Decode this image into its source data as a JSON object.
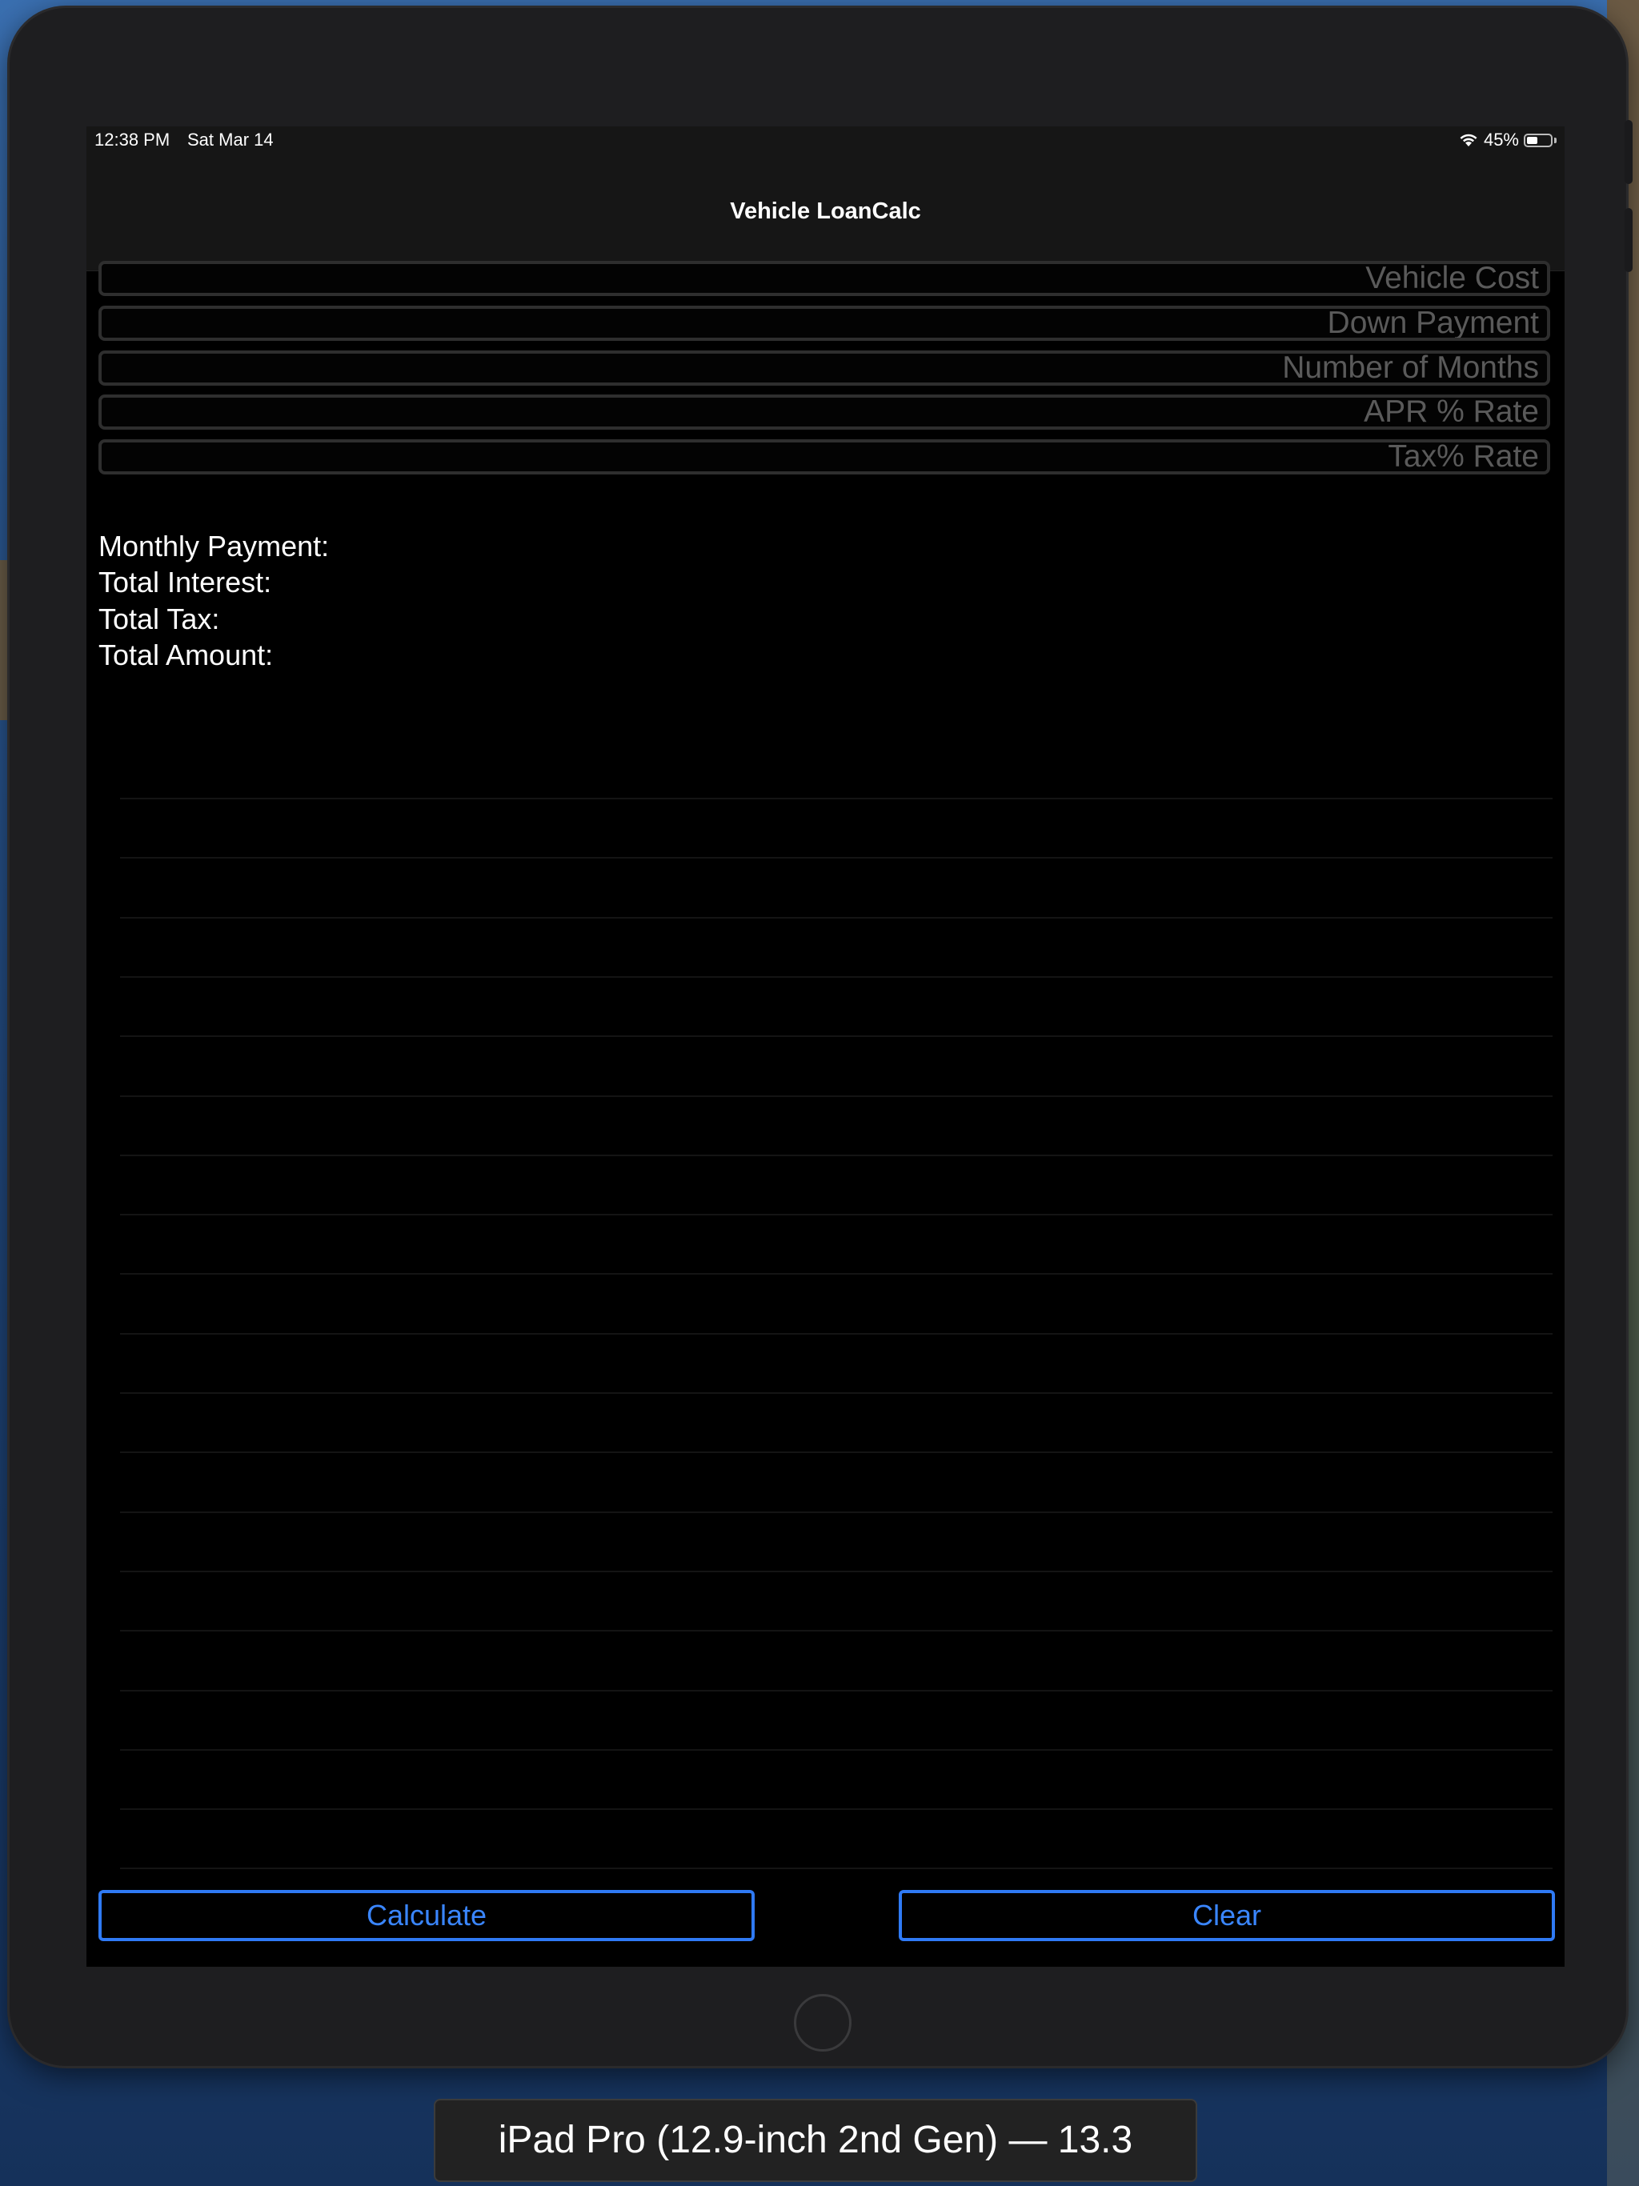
{
  "status_bar": {
    "time": "12:38 PM",
    "date": "Sat Mar 14",
    "battery_percent": "45%",
    "battery_level": 0.45,
    "wifi_icon": "wifi-icon"
  },
  "nav": {
    "title": "Vehicle LoanCalc"
  },
  "inputs": {
    "vehicle_cost": {
      "placeholder": "Vehicle Cost",
      "value": ""
    },
    "down_payment": {
      "placeholder": "Down Payment",
      "value": ""
    },
    "months": {
      "placeholder": "Number of Months",
      "value": ""
    },
    "apr": {
      "placeholder": "APR % Rate",
      "value": ""
    },
    "tax": {
      "placeholder": "Tax% Rate",
      "value": ""
    }
  },
  "results": {
    "monthly_payment": "Monthly Payment:",
    "total_interest": "Total Interest:",
    "total_tax": "Total Tax:",
    "total_amount": "Total Amount:"
  },
  "buttons": {
    "calculate": "Calculate",
    "clear": "Clear"
  },
  "simulator_label": "iPad Pro (12.9-inch 2nd Gen) — 13.3",
  "colors": {
    "accent": "#2f7af5",
    "background": "#000000",
    "placeholder": "#5a5a5a"
  }
}
